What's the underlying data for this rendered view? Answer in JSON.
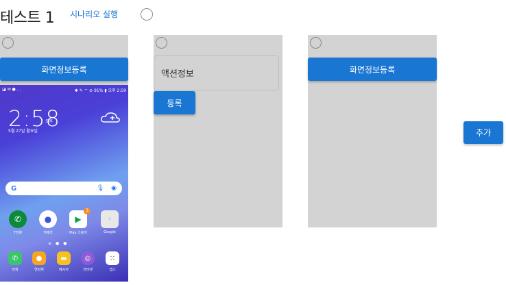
{
  "header": {
    "title": "테스트 1",
    "run_link": "시나리오 실행"
  },
  "panel1": {
    "button_label": "화면정보등록"
  },
  "panel2": {
    "input_value": "액션정보",
    "register_label": "등록"
  },
  "panel3": {
    "button_label": "화면정보등록"
  },
  "add_button": "추가",
  "phone": {
    "status_left": "◪ ✉ ● ...",
    "status_right": "✱ ✎ ⌔ ⊘ 91% ▮ 오후 2:59",
    "clock": "2:58",
    "ampm": "오후",
    "date": "5월 27일 월요일",
    "search_g": "G",
    "apps_row1": [
      {
        "label": "T전화",
        "icon": "phone-icon",
        "color": "#0b8a3a"
      },
      {
        "label": "카메라",
        "icon": "camera-icon",
        "color": "#ffffff"
      },
      {
        "label": "Play 스토어",
        "icon": "play-store-icon",
        "color": "#ffffff"
      },
      {
        "label": "Google",
        "icon": "google-folder-icon",
        "color": "#e8e8e8"
      }
    ],
    "apps_row2": [
      {
        "label": "전화",
        "icon": "dialer-icon",
        "color": "#3cc46c"
      },
      {
        "label": "연락처",
        "icon": "contacts-icon",
        "color": "#f5a623"
      },
      {
        "label": "메시지",
        "icon": "messages-icon",
        "color": "#f8c21c"
      },
      {
        "label": "인터넷",
        "icon": "internet-icon",
        "color": "#8e5bd8"
      },
      {
        "label": "앱스",
        "icon": "apps-grid-icon",
        "color": "#ffffff"
      }
    ],
    "play_badge": "3"
  },
  "colors": {
    "accent": "#1976d2",
    "panel_bg": "#d3d3d3"
  }
}
